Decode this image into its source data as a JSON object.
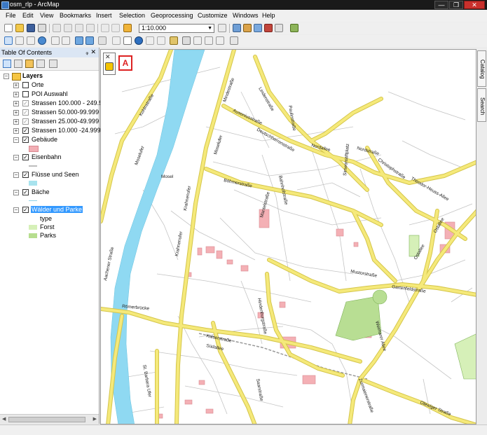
{
  "window": {
    "title": "osm_rlp - ArcMap",
    "minimize": "—",
    "maximize": "❐",
    "close": "✕"
  },
  "menu": [
    "File",
    "Edit",
    "View",
    "Bookmarks",
    "Insert",
    "Selection",
    "Geoprocessing",
    "Customize",
    "Windows",
    "Help"
  ],
  "toolbar": {
    "scale": "1:10.000"
  },
  "toc": {
    "title": "Table Of Contents",
    "pin": "ᵩ",
    "close": "✕",
    "root": "Layers",
    "layers": [
      {
        "name": "Orte",
        "checked": false,
        "expanded": false
      },
      {
        "name": "POI Auswahl",
        "checked": false,
        "expanded": false
      },
      {
        "name": "Strassen 100.000 - 249.999",
        "checked": true,
        "expanded": false,
        "greyed": true
      },
      {
        "name": "Strassen 50.000-99.999",
        "checked": true,
        "expanded": false,
        "greyed": true
      },
      {
        "name": "Strassen 25.000-49.999",
        "checked": true,
        "expanded": false,
        "greyed": true
      },
      {
        "name": "Strassen 10.000 -24.999",
        "checked": true,
        "expanded": false
      },
      {
        "name": "Gebäude",
        "checked": true,
        "expanded": true
      },
      {
        "name": "Eisenbahn",
        "checked": true,
        "expanded": true
      },
      {
        "name": "Flüsse und Seen",
        "checked": true,
        "expanded": true
      },
      {
        "name": "Bäche",
        "checked": true,
        "expanded": true
      },
      {
        "name": "Wälder und Parke",
        "checked": true,
        "expanded": true,
        "selected": true
      }
    ],
    "legend": {
      "field": "type",
      "classes": [
        "Forst",
        "Parks"
      ]
    },
    "colors": {
      "building": "#f2aeb4",
      "railway": "#bdbdbd",
      "water": "#a8e3ee",
      "stream": "#8fd0e6",
      "forest": "#d6f0b8",
      "parks": "#b7de8f",
      "selection": "#3399ff"
    }
  },
  "map": {
    "annotation": "A",
    "river_label": "Mosel",
    "colors": {
      "river": "#8fd9f2",
      "road_major": "#f5e97a",
      "road_major_edge": "#d4c54a",
      "road_minor": "#c9c9c9",
      "building": "#f4b0b5",
      "park": "#b8de93",
      "rail": "#999999"
    },
    "road_labels": [
      "Moselufer",
      "Kohlnstraße",
      "Moselufer",
      "Krahnenufer",
      "Krahnenufer",
      "Mindestraße",
      "Ausoniusstraße",
      "Lindenstraße",
      "Paulinstraße",
      "Deutschherrenstraße",
      "Böhmerstraße",
      "Nordallee",
      "Nordstraße",
      "Christophstraße",
      "Simeonstiftplatz",
      "Theodor-Heuss-Allee",
      "Ostallee",
      "Kaiserstraße",
      "Römerbrücke",
      "Südallee",
      "Weimarer Allee",
      "Ostallee",
      "Gartenfeldstraße",
      "Mustorstraße",
      "St. Barbara Ufer",
      "Olewiger Straße",
      "Saarstraße",
      "Hindenburgstraße",
      "Bahnhofstraße",
      "Aachener Straße",
      "Mantelstraße",
      "Zurmaienerstraße"
    ]
  },
  "right_tabs": [
    "Catalog",
    "Search"
  ]
}
